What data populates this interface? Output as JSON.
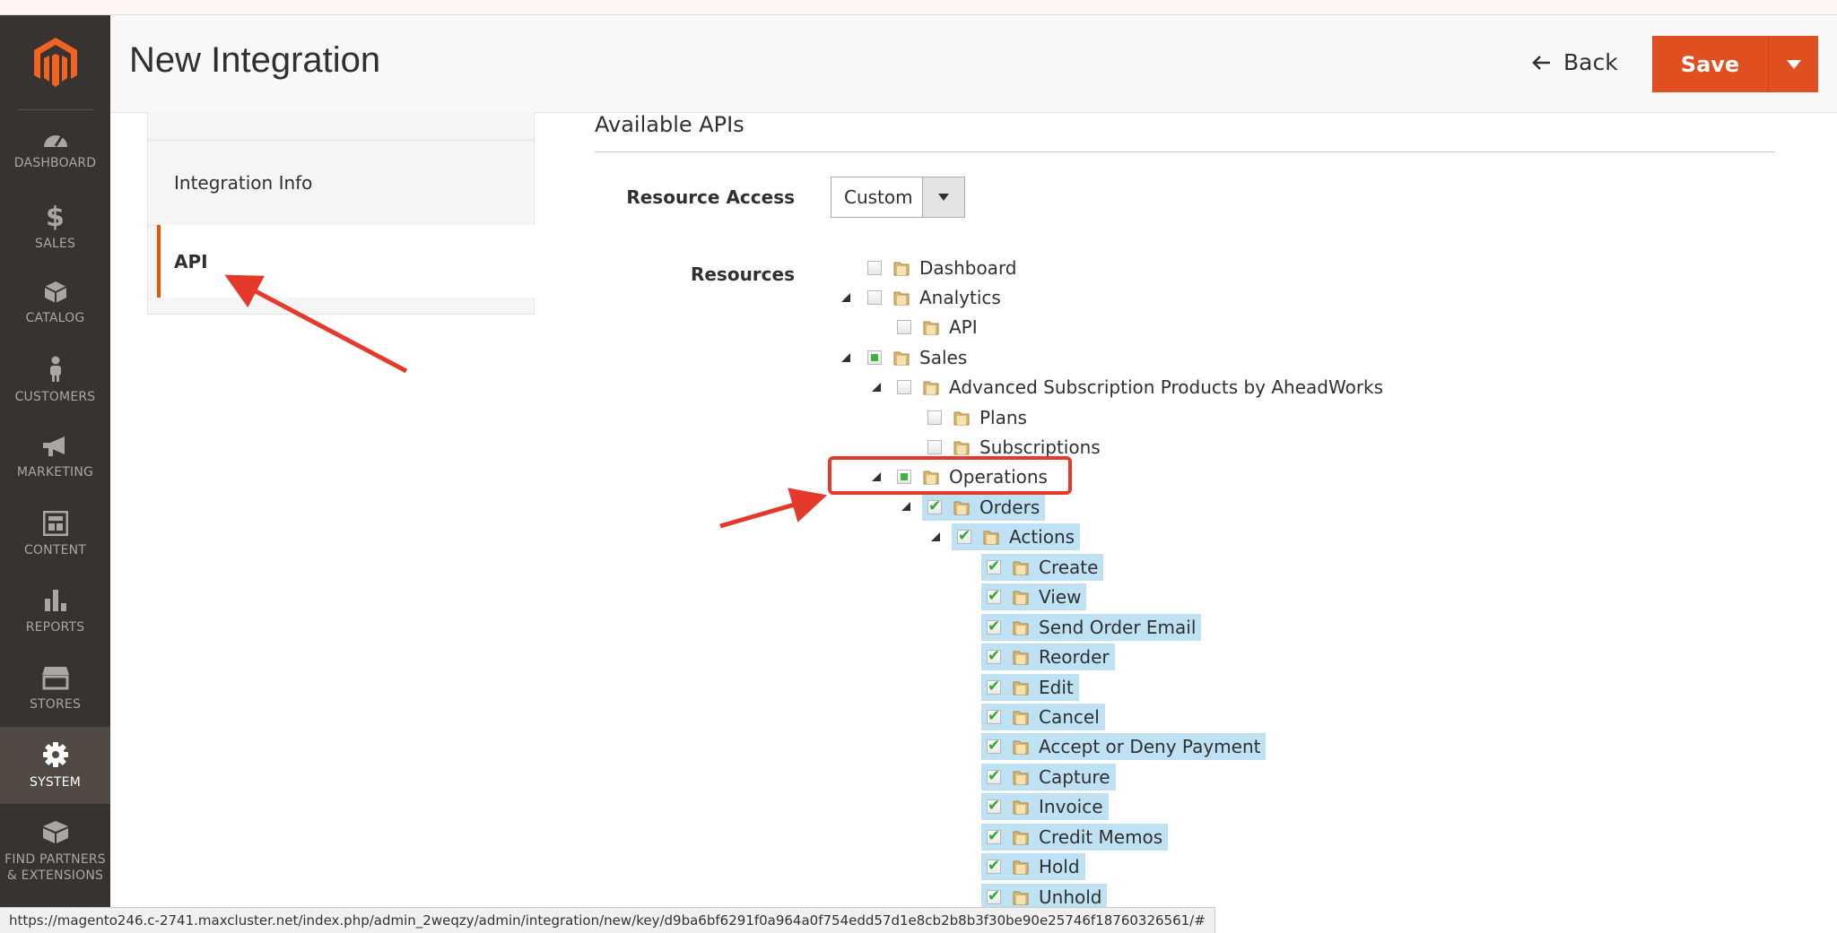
{
  "header": {
    "title": "New Integration",
    "back_label": "Back",
    "save_label": "Save"
  },
  "sidebar": {
    "items": [
      {
        "label": "DASHBOARD",
        "icon": "dashboard-icon"
      },
      {
        "label": "SALES",
        "icon": "dollar-icon"
      },
      {
        "label": "CATALOG",
        "icon": "box-icon"
      },
      {
        "label": "CUSTOMERS",
        "icon": "person-icon"
      },
      {
        "label": "MARKETING",
        "icon": "megaphone-icon"
      },
      {
        "label": "CONTENT",
        "icon": "layout-icon"
      },
      {
        "label": "REPORTS",
        "icon": "bar-chart-icon"
      },
      {
        "label": "STORES",
        "icon": "store-icon"
      },
      {
        "label": "SYSTEM",
        "icon": "gear-icon",
        "active": true
      },
      {
        "label": "FIND PARTNERS & EXTENSIONS",
        "icon": "blocks-icon"
      }
    ]
  },
  "tabs": {
    "info_label": "Integration Info",
    "api_label": "API"
  },
  "main": {
    "section_title": "Available APIs",
    "resource_access_label": "Resource Access",
    "resource_access_value": "Custom",
    "resources_label": "Resources"
  },
  "tree": [
    {
      "label": "Dashboard",
      "state": "unchecked"
    },
    {
      "label": "Analytics",
      "state": "unchecked"
    },
    {
      "label": "API",
      "state": "unchecked"
    },
    {
      "label": "Sales",
      "state": "partial"
    },
    {
      "label": "Advanced Subscription Products by AheadWorks",
      "state": "unchecked"
    },
    {
      "label": "Plans",
      "state": "unchecked"
    },
    {
      "label": "Subscriptions",
      "state": "unchecked"
    },
    {
      "label": "Operations",
      "state": "partial"
    },
    {
      "label": "Orders",
      "state": "checked"
    },
    {
      "label": "Actions",
      "state": "checked"
    },
    {
      "label": "Create",
      "state": "checked"
    },
    {
      "label": "View",
      "state": "checked"
    },
    {
      "label": "Send Order Email",
      "state": "checked"
    },
    {
      "label": "Reorder",
      "state": "checked"
    },
    {
      "label": "Edit",
      "state": "checked"
    },
    {
      "label": "Cancel",
      "state": "checked"
    },
    {
      "label": "Accept or Deny Payment",
      "state": "checked"
    },
    {
      "label": "Capture",
      "state": "checked"
    },
    {
      "label": "Invoice",
      "state": "checked"
    },
    {
      "label": "Credit Memos",
      "state": "checked"
    },
    {
      "label": "Hold",
      "state": "checked"
    },
    {
      "label": "Unhold",
      "state": "checked"
    }
  ],
  "status_url": "https://magento246.c-2741.maxcluster.net/index.php/admin_2weqzy/admin/integration/new/key/d9ba6bf6291f0a964a0f754edd57d1e8cb2b8b3f30be90e25746f18760326561/#",
  "colors": {
    "accent": "#eb5202",
    "save": "#e04f1f",
    "sidebar": "#373330",
    "selection": "#bee1f4",
    "annotation": "#e53a2b"
  }
}
